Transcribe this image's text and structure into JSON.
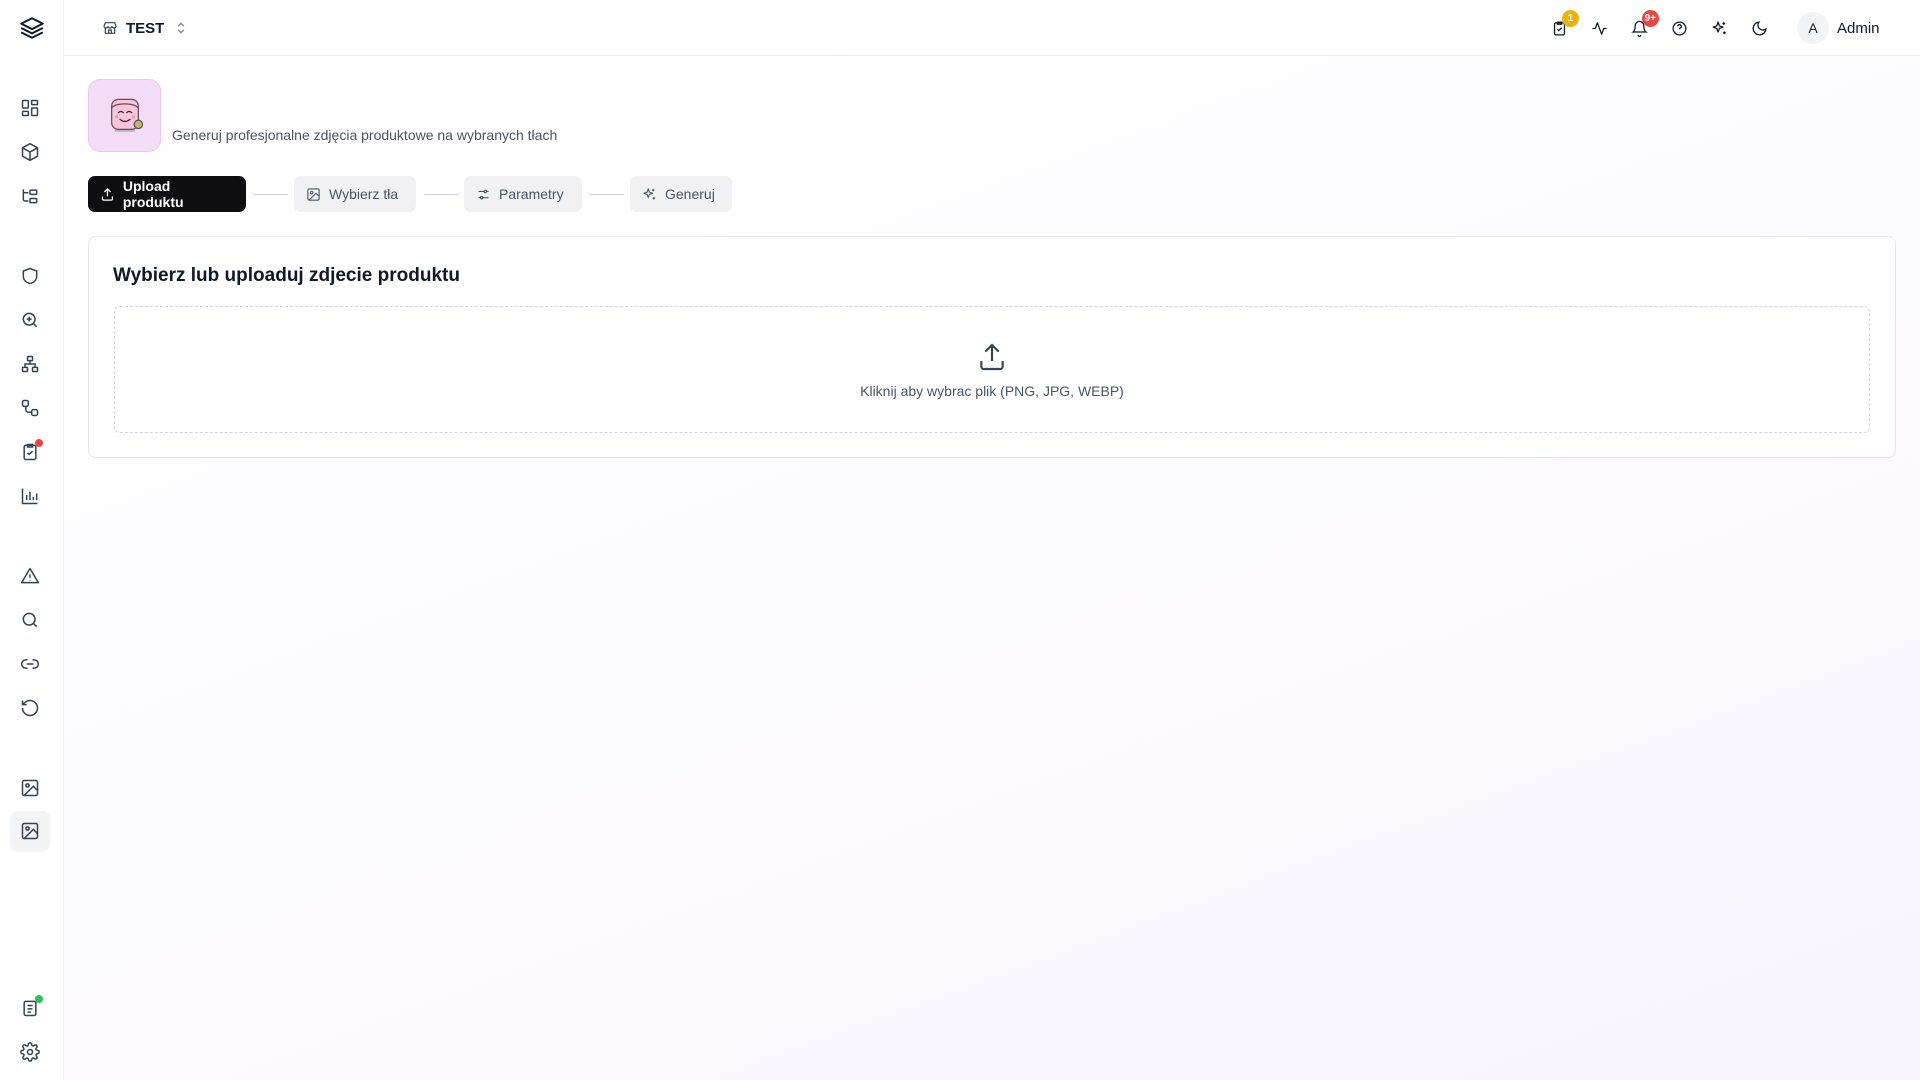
{
  "header": {
    "store_name": "TEST",
    "tasks_badge": "1",
    "notifications_badge": "9+",
    "user": {
      "avatar_letter": "A",
      "name": "Admin"
    }
  },
  "page": {
    "subtitle": "Generuj profesjonalne zdjęcia produktowe na wybranych tłach"
  },
  "steps": [
    {
      "label": "Upload produktu",
      "icon": "upload-icon",
      "active": true
    },
    {
      "label": "Wybierz tła",
      "icon": "image-icon",
      "active": false
    },
    {
      "label": "Parametry",
      "icon": "sliders-icon",
      "active": false
    },
    {
      "label": "Generuj",
      "icon": "sparkles-icon",
      "active": false
    }
  ],
  "upload_card": {
    "title": "Wybierz lub uploaduj zdjecie produktu",
    "dropzone_text": "Kliknij aby wybrac plik (PNG, JPG, WEBP)"
  },
  "sidebar": {
    "icons": [
      "dashboard-icon",
      "package-icon",
      "hierarchy-icon",
      "shield-icon",
      "search-zoom-icon",
      "network-icon",
      "workflow-icon",
      "checklist-icon",
      "bar-chart-icon",
      "alert-icon",
      "search-icon",
      "link-icon",
      "history-icon",
      "image-icon",
      "image-edit-icon",
      "clipboard-icon",
      "settings-icon"
    ]
  },
  "colors": {
    "primary": "#0f0f12",
    "badge_yellow": "#eab308",
    "badge_red": "#ef4444",
    "status_green": "#22c55e",
    "module_bg": "#f3dcf5"
  }
}
